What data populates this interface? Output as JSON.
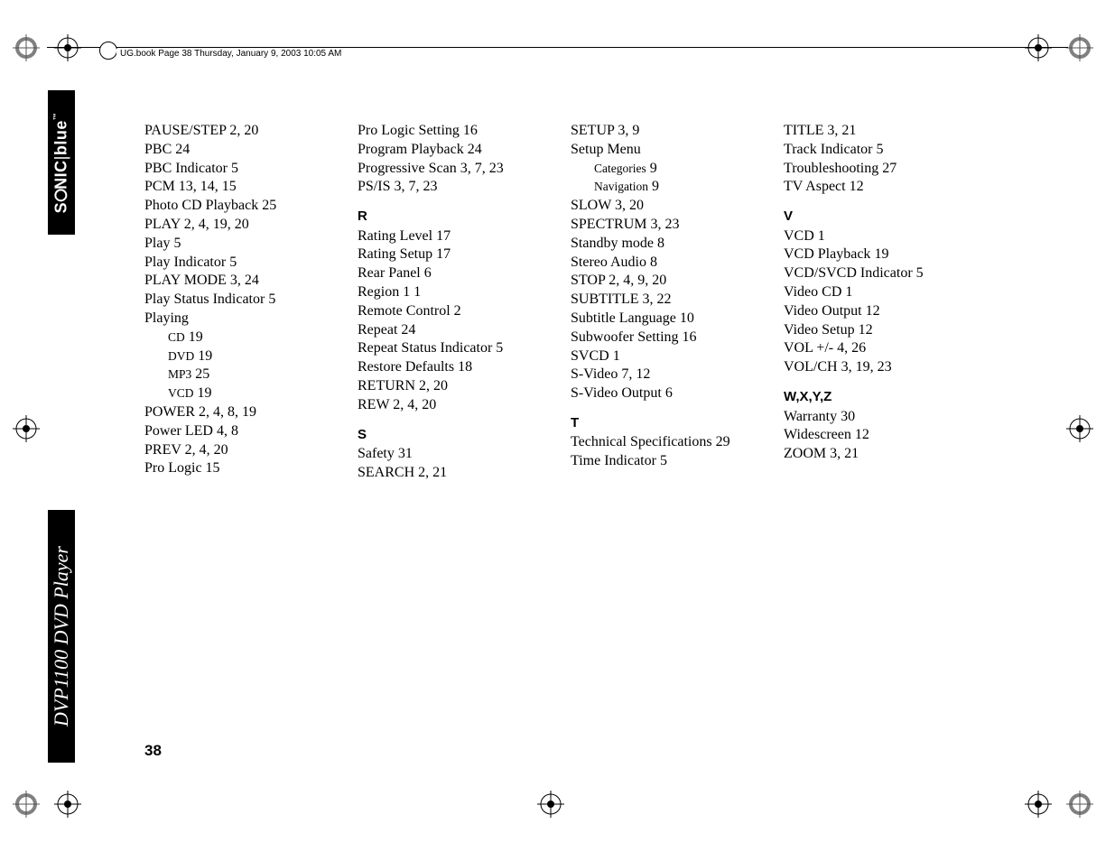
{
  "meta": {
    "header_text": "UG.book  Page 38  Thursday, January 9, 2003  10:05 AM",
    "brand": "SONIC|blue",
    "product": "DVP1100 DVD Player",
    "page_number": "38"
  },
  "index": [
    {
      "type": "entry",
      "term": "PAUSE/STEP",
      "pages": "2, 20"
    },
    {
      "type": "entry",
      "term": "PBC",
      "pages": "24"
    },
    {
      "type": "entry",
      "term": "PBC Indicator",
      "pages": "5"
    },
    {
      "type": "entry",
      "term": "PCM",
      "pages": "13, 14, 15"
    },
    {
      "type": "entry",
      "term": "Photo CD Playback",
      "pages": "25"
    },
    {
      "type": "entry",
      "term": "PLAY",
      "pages": "2, 4, 19, 20"
    },
    {
      "type": "entry",
      "term": "Play",
      "pages": "5"
    },
    {
      "type": "entry",
      "term": "Play Indicator",
      "pages": "5"
    },
    {
      "type": "entry",
      "term": "PLAY MODE",
      "pages": "3, 24"
    },
    {
      "type": "entry",
      "term": "Play Status Indicator",
      "pages": "5"
    },
    {
      "type": "entry",
      "term": "Playing",
      "pages": ""
    },
    {
      "type": "sub",
      "term": "CD",
      "pages": "19"
    },
    {
      "type": "sub",
      "term": "DVD",
      "pages": "19"
    },
    {
      "type": "sub",
      "term": "MP3",
      "pages": "25"
    },
    {
      "type": "sub",
      "term": "VCD",
      "pages": "19"
    },
    {
      "type": "entry",
      "term": "POWER",
      "pages": "2, 4, 8, 19"
    },
    {
      "type": "entry",
      "term": "Power LED",
      "pages": "4, 8"
    },
    {
      "type": "entry",
      "term": "PREV",
      "pages": "2, 4, 20"
    },
    {
      "type": "entry",
      "term": "Pro Logic",
      "pages": "15"
    },
    {
      "type": "entry",
      "term": "Pro Logic Setting",
      "pages": "16"
    },
    {
      "type": "entry",
      "term": "Program Playback",
      "pages": "24"
    },
    {
      "type": "entry",
      "term": "Progressive Scan",
      "pages": "3, 7, 23"
    },
    {
      "type": "entry",
      "term": "PS/IS",
      "pages": "3, 7, 23"
    },
    {
      "type": "heading",
      "label": "R"
    },
    {
      "type": "entry",
      "term": "Rating Level",
      "pages": "17"
    },
    {
      "type": "entry",
      "term": "Rating Setup",
      "pages": "17"
    },
    {
      "type": "entry",
      "term": "Rear Panel",
      "pages": "6"
    },
    {
      "type": "entry",
      "term": "Region 1",
      "pages": "1"
    },
    {
      "type": "entry",
      "term": "Remote Control",
      "pages": "2"
    },
    {
      "type": "entry",
      "term": "Repeat",
      "pages": "24"
    },
    {
      "type": "entry",
      "term": "Repeat Status Indicator",
      "pages": "5"
    },
    {
      "type": "entry",
      "term": "Restore Defaults",
      "pages": "18"
    },
    {
      "type": "entry",
      "term": "RETURN",
      "pages": "2, 20"
    },
    {
      "type": "entry",
      "term": "REW",
      "pages": "2, 4, 20"
    },
    {
      "type": "heading",
      "label": "S"
    },
    {
      "type": "entry",
      "term": "Safety",
      "pages": "31"
    },
    {
      "type": "entry",
      "term": "SEARCH",
      "pages": "2, 21"
    },
    {
      "type": "entry",
      "term": "SETUP",
      "pages": "3, 9"
    },
    {
      "type": "entry",
      "term": "Setup Menu",
      "pages": ""
    },
    {
      "type": "sub",
      "term": "Categories",
      "pages": "9"
    },
    {
      "type": "sub",
      "term": "Navigation",
      "pages": "9"
    },
    {
      "type": "entry",
      "term": "SLOW",
      "pages": "3, 20"
    },
    {
      "type": "entry",
      "term": "SPECTRUM",
      "pages": "3, 23"
    },
    {
      "type": "entry",
      "term": "Standby mode",
      "pages": "8"
    },
    {
      "type": "entry",
      "term": "Stereo Audio",
      "pages": "8"
    },
    {
      "type": "entry",
      "term": "STOP",
      "pages": "2, 4, 9, 20"
    },
    {
      "type": "entry",
      "term": "SUBTITLE",
      "pages": "3, 22"
    },
    {
      "type": "entry",
      "term": "Subtitle Language",
      "pages": "10"
    },
    {
      "type": "entry",
      "term": "Subwoofer Setting",
      "pages": "16"
    },
    {
      "type": "entry",
      "term": "SVCD",
      "pages": "1"
    },
    {
      "type": "entry",
      "term": "S-Video",
      "pages": "7, 12"
    },
    {
      "type": "entry",
      "term": "S-Video Output",
      "pages": "6"
    },
    {
      "type": "heading",
      "label": "T"
    },
    {
      "type": "entry",
      "term": "Technical Specifications",
      "pages": "29"
    },
    {
      "type": "entry",
      "term": "Time Indicator",
      "pages": "5"
    },
    {
      "type": "entry",
      "term": "TITLE",
      "pages": "3, 21"
    },
    {
      "type": "entry",
      "term": "Track Indicator",
      "pages": "5"
    },
    {
      "type": "entry",
      "term": "Troubleshooting",
      "pages": "27"
    },
    {
      "type": "entry",
      "term": "TV Aspect",
      "pages": "12"
    },
    {
      "type": "heading",
      "label": "V"
    },
    {
      "type": "entry",
      "term": "VCD",
      "pages": "1"
    },
    {
      "type": "entry",
      "term": "VCD Playback",
      "pages": "19"
    },
    {
      "type": "entry",
      "term": "VCD/SVCD Indicator",
      "pages": "5"
    },
    {
      "type": "entry",
      "term": "Video CD",
      "pages": "1"
    },
    {
      "type": "entry",
      "term": "Video Output",
      "pages": "12"
    },
    {
      "type": "entry",
      "term": "Video Setup",
      "pages": "12"
    },
    {
      "type": "entry",
      "term": "VOL +/-",
      "pages": "4, 26"
    },
    {
      "type": "entry",
      "term": "VOL/CH",
      "pages": "3, 19, 23"
    },
    {
      "type": "heading",
      "label": "W,X,Y,Z"
    },
    {
      "type": "entry",
      "term": "Warranty",
      "pages": "30"
    },
    {
      "type": "entry",
      "term": "Widescreen",
      "pages": "12"
    },
    {
      "type": "entry",
      "term": "ZOOM",
      "pages": "3, 21"
    }
  ]
}
